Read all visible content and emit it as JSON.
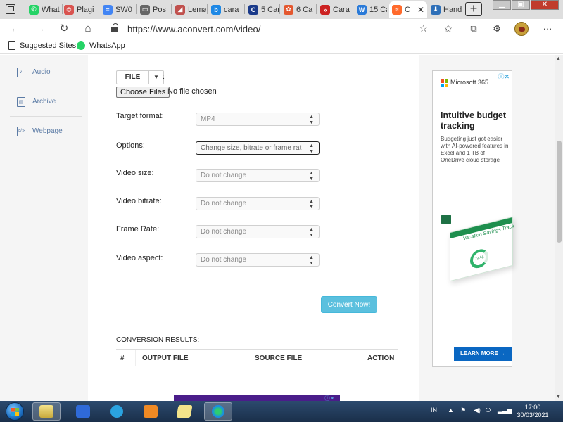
{
  "browser": {
    "tabs": [
      {
        "label": "What",
        "fav_color": "#25d366",
        "fav_glyph": "✆"
      },
      {
        "label": "Plagi",
        "fav_color": "#d9534f",
        "fav_glyph": "©"
      },
      {
        "label": "SW0",
        "fav_color": "#4285f4",
        "fav_glyph": "≡"
      },
      {
        "label": "Pos",
        "fav_color": "#666666",
        "fav_glyph": "▭"
      },
      {
        "label": "Lema",
        "fav_color": "#c0504d",
        "fav_glyph": "◢"
      },
      {
        "label": "cara",
        "fav_color": "#1e88e5",
        "fav_glyph": "b"
      },
      {
        "label": "5 Car",
        "fav_color": "#1a3a8a",
        "fav_glyph": "C"
      },
      {
        "label": "6 Ca",
        "fav_color": "#e4572e",
        "fav_glyph": "✿"
      },
      {
        "label": "Cara",
        "fav_color": "#cc2222",
        "fav_glyph": "»"
      },
      {
        "label": "15 Ca",
        "fav_color": "#2a7ad8",
        "fav_glyph": "W"
      },
      {
        "label": "C",
        "fav_color": "#ff6a2c",
        "fav_glyph": "≈",
        "active": true
      },
      {
        "label": "Hand",
        "fav_color": "#2d6fb8",
        "fav_glyph": "⬇"
      }
    ],
    "new_tab_label": "+",
    "url": "https://www.aconvert.com/video/",
    "bookmarks": [
      {
        "label": "Suggested Sites"
      },
      {
        "label": "WhatsApp"
      }
    ]
  },
  "sidebar": {
    "items": [
      {
        "label": "Audio",
        "icon": "audio-file-icon"
      },
      {
        "label": "Archive",
        "icon": "archive-file-icon"
      },
      {
        "label": "Webpage",
        "icon": "webpage-file-icon"
      }
    ]
  },
  "form": {
    "file_source_label": "FILE",
    "choose_files_label": "Choose Files",
    "no_file_text": "No file chosen",
    "rows": [
      {
        "label": "Target format:",
        "value": "MP4"
      },
      {
        "label": "Options:",
        "value": "Change size, bitrate or frame rat"
      },
      {
        "label": "Video size:",
        "value": "Do not change"
      },
      {
        "label": "Video bitrate:",
        "value": "Do not change"
      },
      {
        "label": "Frame Rate:",
        "value": "Do not change"
      },
      {
        "label": "Video aspect:",
        "value": "Do not change"
      }
    ],
    "convert_label": "Convert Now!"
  },
  "results": {
    "title": "CONVERSION RESULTS:",
    "columns": [
      "#",
      "OUTPUT FILE",
      "SOURCE FILE",
      "ACTION"
    ]
  },
  "ad": {
    "brand": "Microsoft 365",
    "headline": "Intuitive budget tracking",
    "body": "Budgeting just got easier with AI-powered features in Excel and 1 TB of OneDrive cloud storage",
    "sheet_title": "Vacation Savings Track",
    "percent": "74%",
    "cta": "LEARN MORE →"
  },
  "taskbar": {
    "language": "IN",
    "time": "17:00",
    "date": "30/03/2021"
  }
}
